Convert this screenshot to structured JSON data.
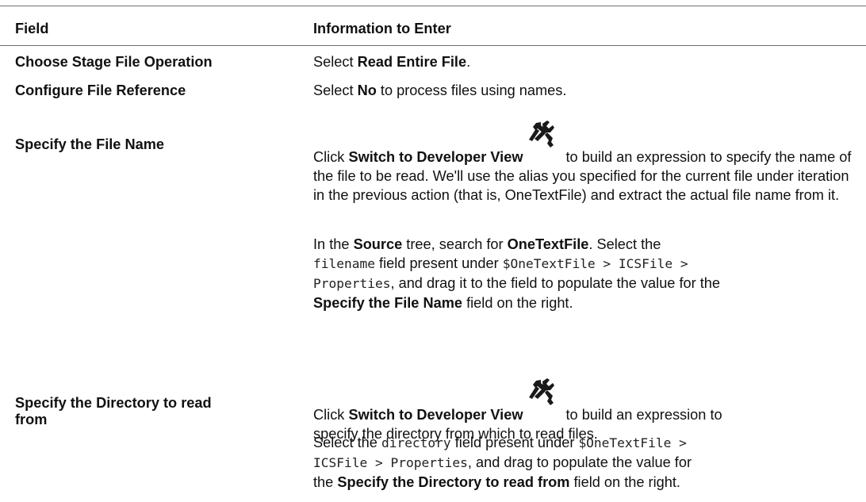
{
  "table": {
    "header": {
      "field": "Field",
      "info": "Information to Enter"
    },
    "rows": [
      {
        "field": "Choose Stage File Operation",
        "info": {
          "pre": "Select ",
          "bold": "Read Entire File",
          "post": "."
        }
      },
      {
        "field": "Configure File Reference",
        "info": {
          "pre": "Select ",
          "bold": "No",
          "post": " to process files using names."
        }
      },
      {
        "field": "Specify the File Name",
        "p1": {
          "click": "Click ",
          "button": "Switch to Developer View",
          "icon": "developer-view-icon",
          "after_icon": "to build an expression to",
          "rest": "specify the name of the file to be read. We'll use the alias you specified for the current file under iteration in the previous action (that is, OneTextFile) and extract the actual file name from it."
        },
        "p2": {
          "t1": "In the ",
          "b1": "Source",
          "t2": " tree, search for ",
          "b2": "OneTextFile",
          "t3": ". Select the",
          "code1": "filename",
          "t4": " field present under ",
          "code2": "$OneTextFile > ICSFile >",
          "code3": "Properties",
          "t5": ", and drag it to the field to populate the value for the",
          "b3": "Specify the File Name",
          "t6": " field on the right."
        }
      },
      {
        "field_line1": "Specify the Directory to read",
        "field_line2": "from",
        "p1": {
          "click": "Click ",
          "button": "Switch to Developer View",
          "icon": "developer-view-icon",
          "after_icon": "to build an expression to",
          "rest": "specify the directory from which to read files."
        },
        "p2": {
          "t1": "Select the ",
          "code1": "directory",
          "t2": " field present under ",
          "code2": "$OneTextFile >",
          "code3": "ICSFile > Properties",
          "t3": ", and drag to populate the value for",
          "t4": "the ",
          "b1": "Specify the Directory to read from",
          "t5": " field on the right."
        }
      }
    ]
  }
}
